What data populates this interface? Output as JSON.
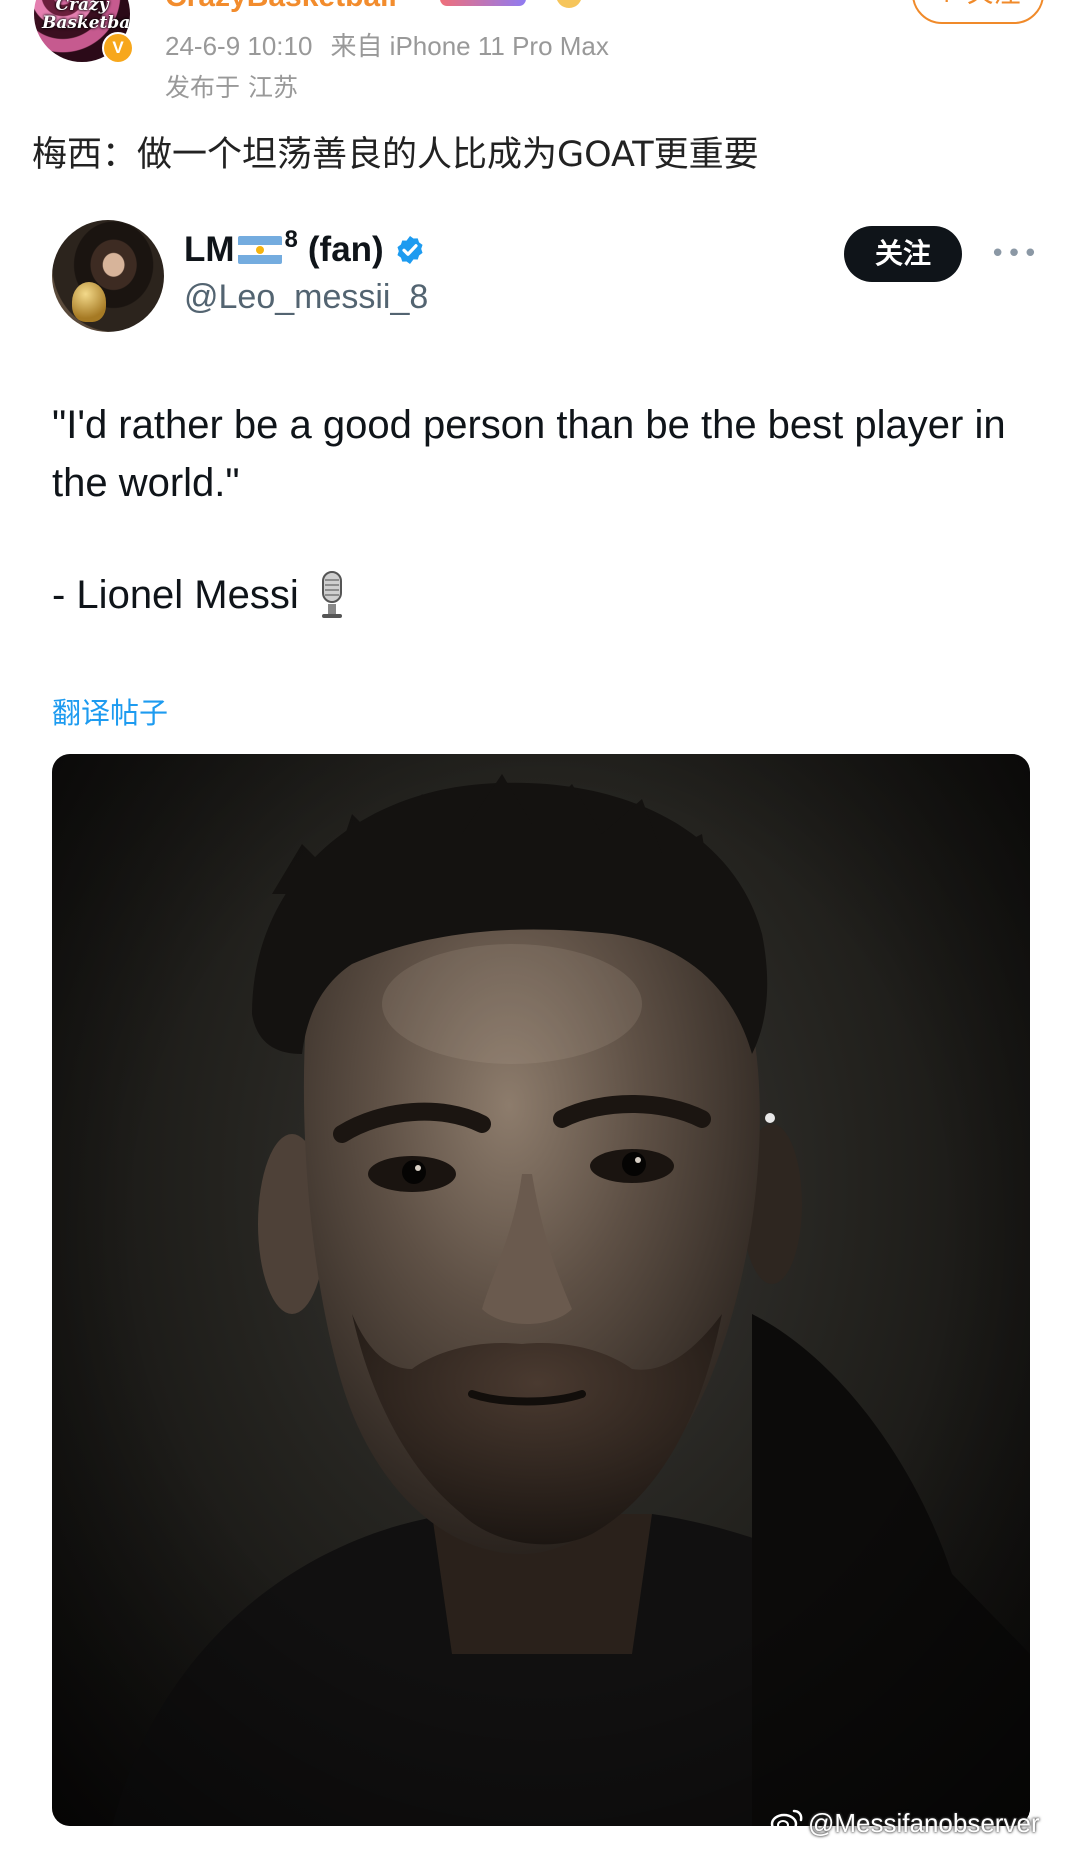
{
  "weibo": {
    "avatar_text": "Crazy Basketball",
    "verified_badge": "V",
    "username": "CrazyBasketball",
    "post_time": "24-6-9 10:10",
    "source": "来自 iPhone 11 Pro Max",
    "location": "发布于 江苏",
    "follow_label": "+ 关注",
    "post_text": "梅西：做一个坦荡善良的人比成为GOAT更重要"
  },
  "tweet": {
    "display_name_prefix": "LM",
    "display_name_sup": "8",
    "display_name_suffix": "(fan)",
    "handle": "@Leo_messii_8",
    "follow_label": "关注",
    "more_label": "•••",
    "quote": "\"I'd rather be a good person than be the best player in the world.\"",
    "author": "- Lionel Messi",
    "translate_label": "翻译帖子"
  },
  "watermark": {
    "text": "@Messifanobserver"
  },
  "colors": {
    "weibo_orange": "#f08a2a",
    "twitter_blue": "#1d9bf0",
    "follow_black": "#0f1419",
    "meta_gray": "#999999"
  }
}
